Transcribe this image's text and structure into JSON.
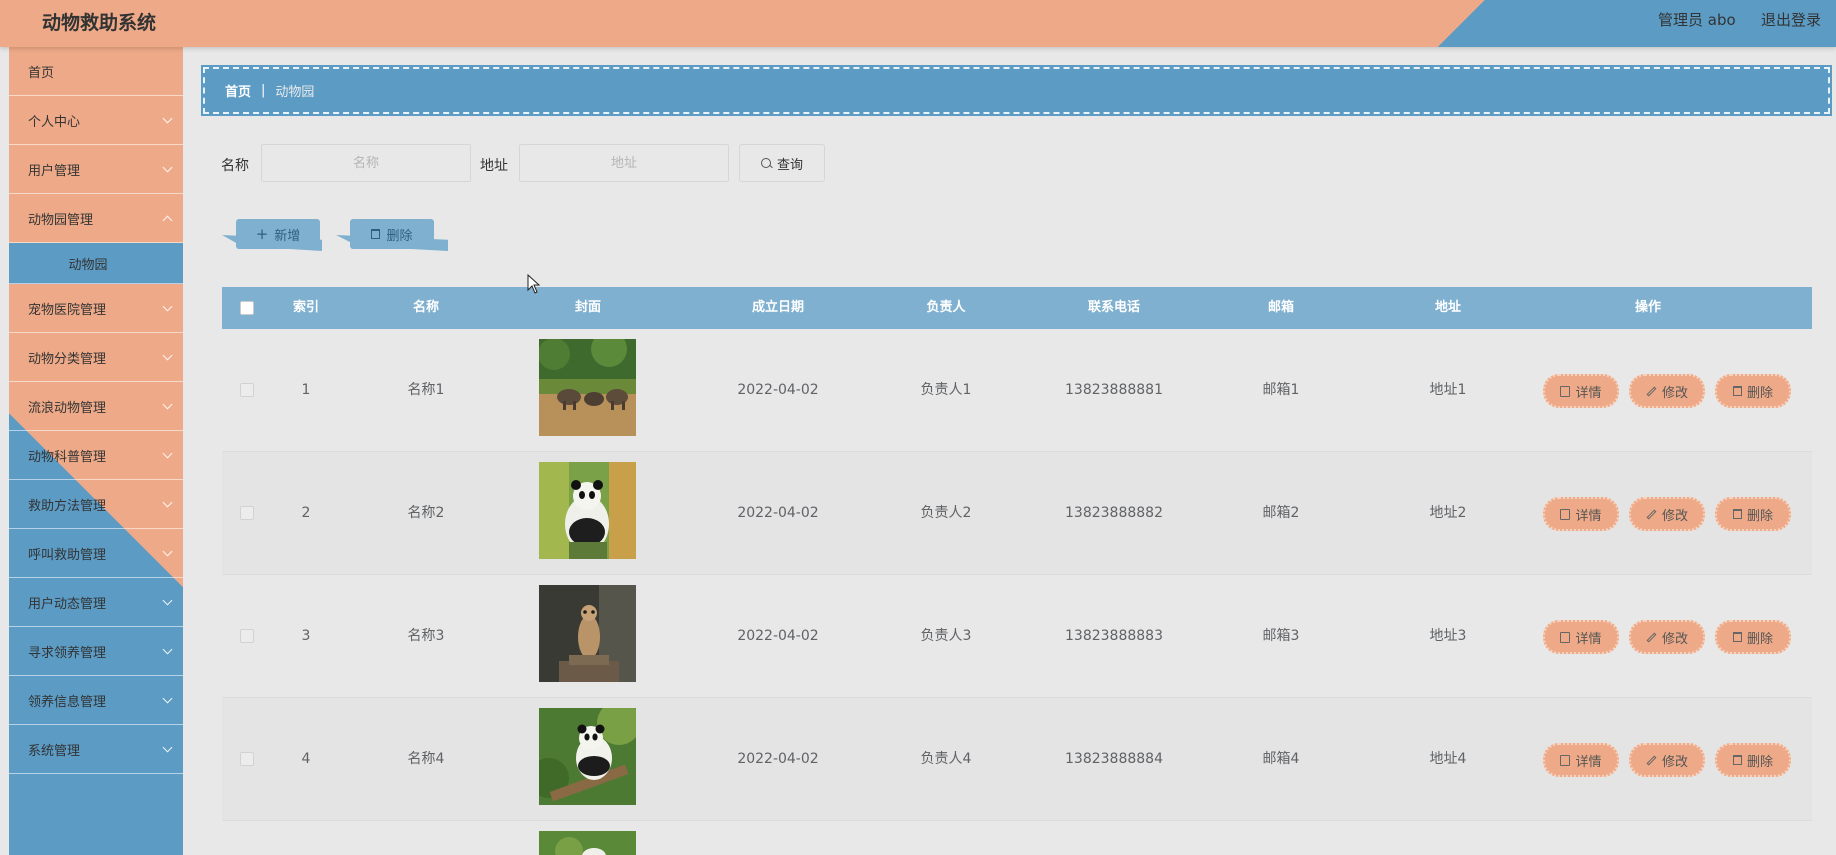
{
  "header": {
    "title": "动物救助系统",
    "admin": "管理员 abo",
    "logout": "退出登录"
  },
  "sidebar": {
    "items": [
      {
        "label": "首页",
        "has_arrow": false
      },
      {
        "label": "个人中心",
        "has_arrow": true
      },
      {
        "label": "用户管理",
        "has_arrow": true
      },
      {
        "label": "动物园管理",
        "has_arrow": true
      },
      {
        "label": "宠物医院管理",
        "has_arrow": true
      },
      {
        "label": "动物分类管理",
        "has_arrow": true
      },
      {
        "label": "流浪动物管理",
        "has_arrow": true
      },
      {
        "label": "动物科普管理",
        "has_arrow": true
      },
      {
        "label": "救助方法管理",
        "has_arrow": true
      },
      {
        "label": "呼叫救助管理",
        "has_arrow": true
      },
      {
        "label": "用户动态管理",
        "has_arrow": true
      },
      {
        "label": "寻求领养管理",
        "has_arrow": true
      },
      {
        "label": "领养信息管理",
        "has_arrow": true
      },
      {
        "label": "系统管理",
        "has_arrow": true
      }
    ],
    "active_sub": "动物园"
  },
  "breadcrumb": {
    "home": "首页",
    "separator": "|",
    "current": "动物园"
  },
  "search": {
    "name_label": "名称",
    "name_placeholder": "名称",
    "address_label": "地址",
    "address_placeholder": "地址",
    "query_label": "查询"
  },
  "actions": {
    "add_label": "新增",
    "delete_label": "删除"
  },
  "table": {
    "columns": [
      "索引",
      "名称",
      "封面",
      "成立日期",
      "负责人",
      "联系电话",
      "邮箱",
      "地址",
      "操作"
    ],
    "rows": [
      {
        "index": "1",
        "name": "名称1",
        "cover": "elephants",
        "date": "2022-04-02",
        "manager": "负责人1",
        "phone": "13823888881",
        "email": "邮箱1",
        "address": "地址1"
      },
      {
        "index": "2",
        "name": "名称2",
        "cover": "panda",
        "date": "2022-04-02",
        "manager": "负责人2",
        "phone": "13823888882",
        "email": "邮箱2",
        "address": "地址2"
      },
      {
        "index": "3",
        "name": "名称3",
        "cover": "meerkat",
        "date": "2022-04-02",
        "manager": "负责人3",
        "phone": "13823888883",
        "email": "邮箱3",
        "address": "地址3"
      },
      {
        "index": "4",
        "name": "名称4",
        "cover": "panda-tree",
        "date": "2022-04-02",
        "manager": "负责人4",
        "phone": "13823888884",
        "email": "邮箱4",
        "address": "地址4"
      }
    ],
    "row_actions": {
      "detail": "详情",
      "edit": "修改",
      "delete": "删除"
    }
  },
  "colors": {
    "primary_orange": "#eeaa88",
    "primary_blue": "#5b9bc4",
    "table_header": "#7fb0cf"
  }
}
